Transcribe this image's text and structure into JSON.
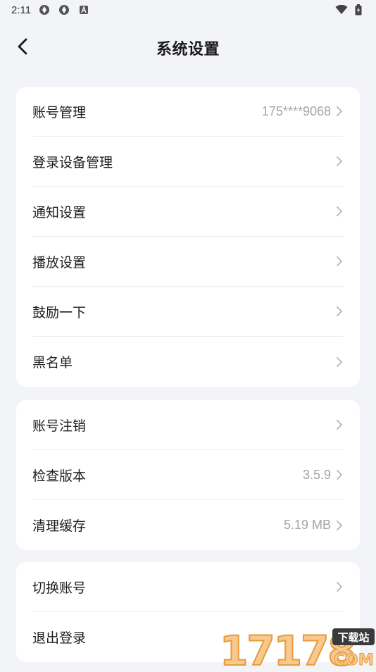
{
  "status_bar": {
    "time": "2:11",
    "left_icons": [
      "app-icon",
      "app-icon",
      "notification-a-icon"
    ],
    "right_icons": [
      "wifi-icon",
      "battery-icon"
    ]
  },
  "header": {
    "title": "系统设置",
    "back_icon": "chevron-left-icon"
  },
  "groups": [
    {
      "items": [
        {
          "label": "账号管理",
          "value": "175****9068"
        },
        {
          "label": "登录设备管理",
          "value": ""
        },
        {
          "label": "通知设置",
          "value": ""
        },
        {
          "label": "播放设置",
          "value": ""
        },
        {
          "label": "鼓励一下",
          "value": ""
        },
        {
          "label": "黑名单",
          "value": ""
        }
      ]
    },
    {
      "items": [
        {
          "label": "账号注销",
          "value": ""
        },
        {
          "label": "检查版本",
          "value": "3.5.9"
        },
        {
          "label": "清理缓存",
          "value": "5.19 MB"
        }
      ]
    },
    {
      "items": [
        {
          "label": "切换账号",
          "value": ""
        },
        {
          "label": "退出登录",
          "value": ""
        }
      ]
    }
  ],
  "watermark": {
    "number": "17178",
    "tag": "下载站",
    "domain": "COM"
  },
  "colors": {
    "background": "#f3f4f7",
    "card": "#ffffff",
    "value_text": "#a4a4a4",
    "chevron": "#b5b5b5",
    "watermark_orange": "#f0a24a"
  }
}
